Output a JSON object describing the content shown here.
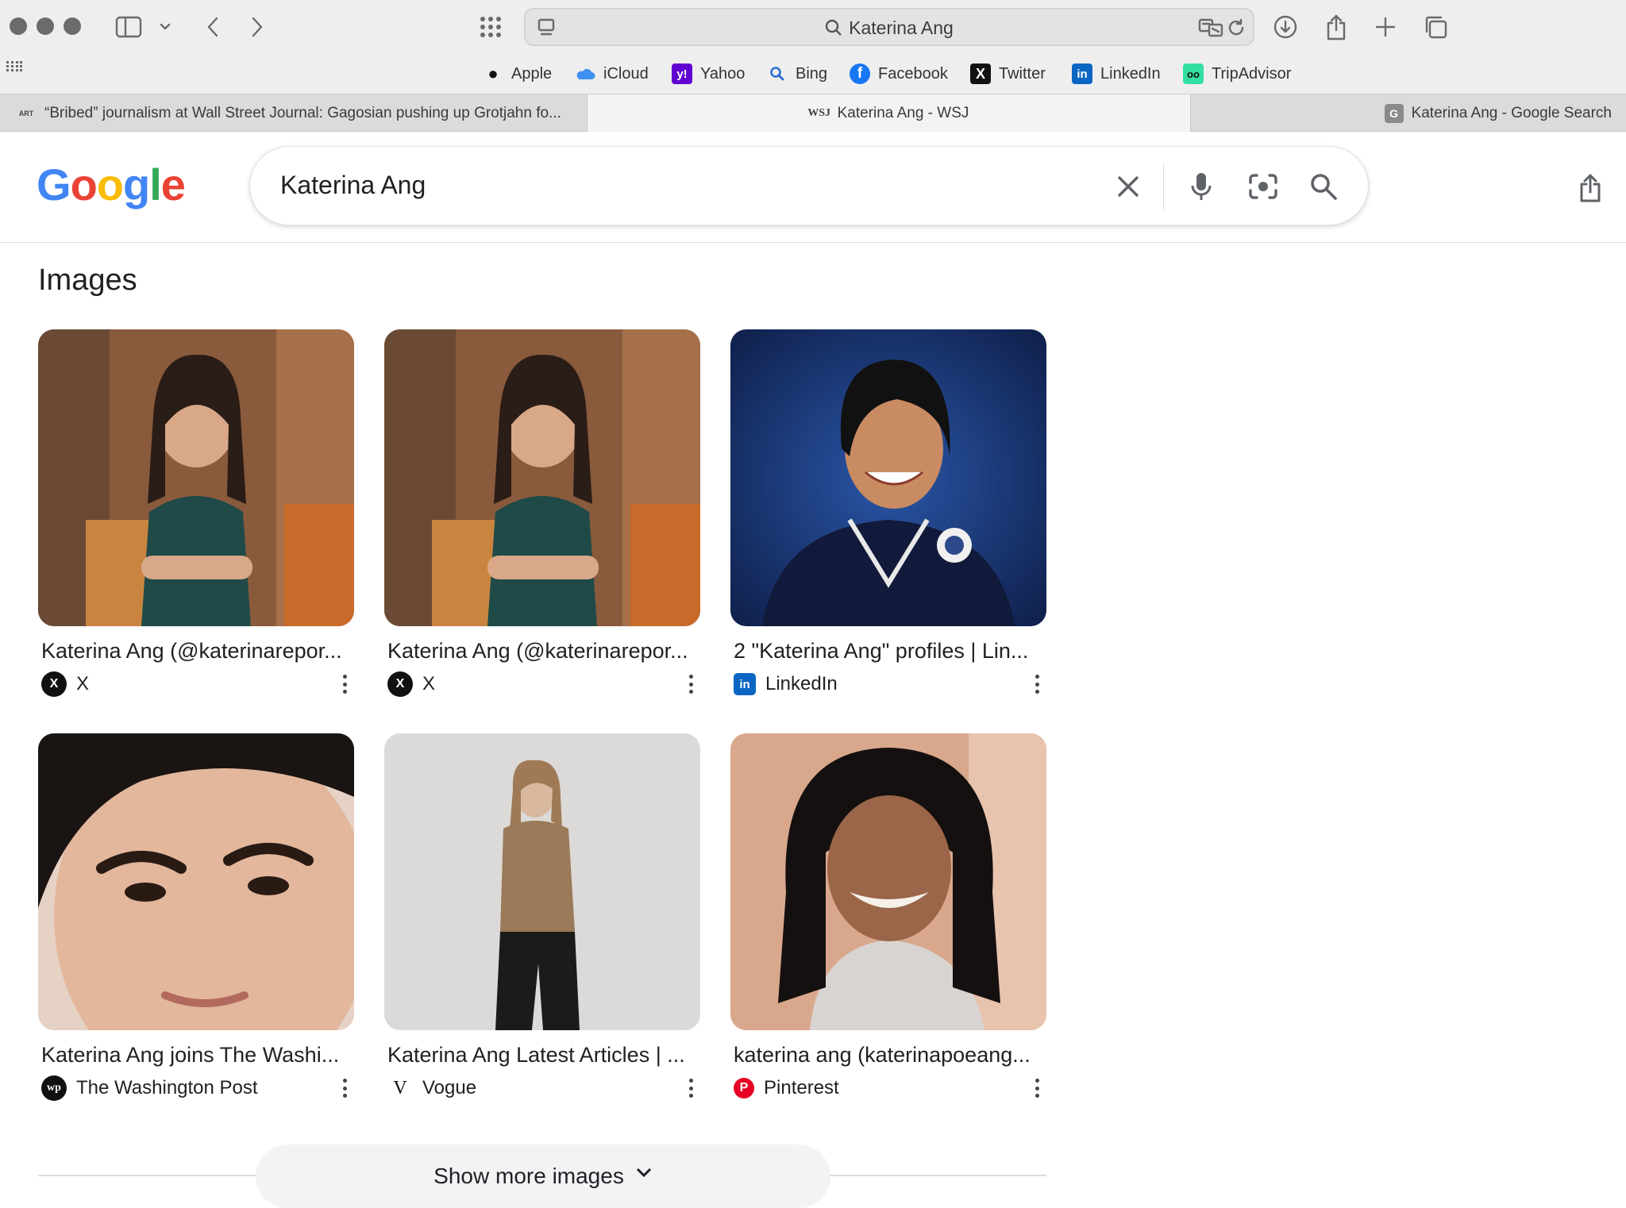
{
  "browser": {
    "address_text": "Katerina Ang",
    "bookmarks": [
      {
        "label": "Apple",
        "icon": "apple-icon"
      },
      {
        "label": "iCloud",
        "icon": "icloud-icon"
      },
      {
        "label": "Yahoo",
        "icon": "yahoo-icon"
      },
      {
        "label": "Bing",
        "icon": "bing-icon"
      },
      {
        "label": "Facebook",
        "icon": "facebook-icon"
      },
      {
        "label": "Twitter",
        "icon": "twitter-icon"
      },
      {
        "label": "LinkedIn",
        "icon": "linkedin-icon"
      },
      {
        "label": "TripAdvisor",
        "icon": "tripadvisor-icon"
      }
    ],
    "tabs": [
      {
        "label": "“Bribed” journalism at Wall Street Journal: Gagosian pushing up Grotjahn fo...",
        "active": false
      },
      {
        "label": "Katerina Ang - WSJ",
        "active": true,
        "favicon": "WSJ"
      },
      {
        "label": "Katerina Ang - Google Search",
        "active": false,
        "favicon": "G"
      }
    ]
  },
  "google": {
    "logo": "Google",
    "query": "Katerina Ang",
    "section_title": "Images",
    "results": [
      {
        "title": "Katerina Ang (@katerinarepor...",
        "source": "X",
        "icon": "x-icon"
      },
      {
        "title": "Katerina Ang (@katerinarepor...",
        "source": "X",
        "icon": "x-icon"
      },
      {
        "title": "2 \"Katerina Ang\" profiles | Lin...",
        "source": "LinkedIn",
        "icon": "linkedin-icon"
      },
      {
        "title": "Katerina Ang joins The Washi...",
        "source": "The Washington Post",
        "icon": "washington-post-icon"
      },
      {
        "title": "Katerina Ang Latest Articles | ...",
        "source": "Vogue",
        "icon": "vogue-icon"
      },
      {
        "title": "katerina ang (katerinapoeang...",
        "source": "Pinterest",
        "icon": "pinterest-icon"
      }
    ],
    "show_more_label": "Show more images"
  },
  "colors": {
    "google_blue": "#4285F4",
    "google_red": "#EA4335",
    "google_yellow": "#FBBC05",
    "google_green": "#34A853"
  }
}
